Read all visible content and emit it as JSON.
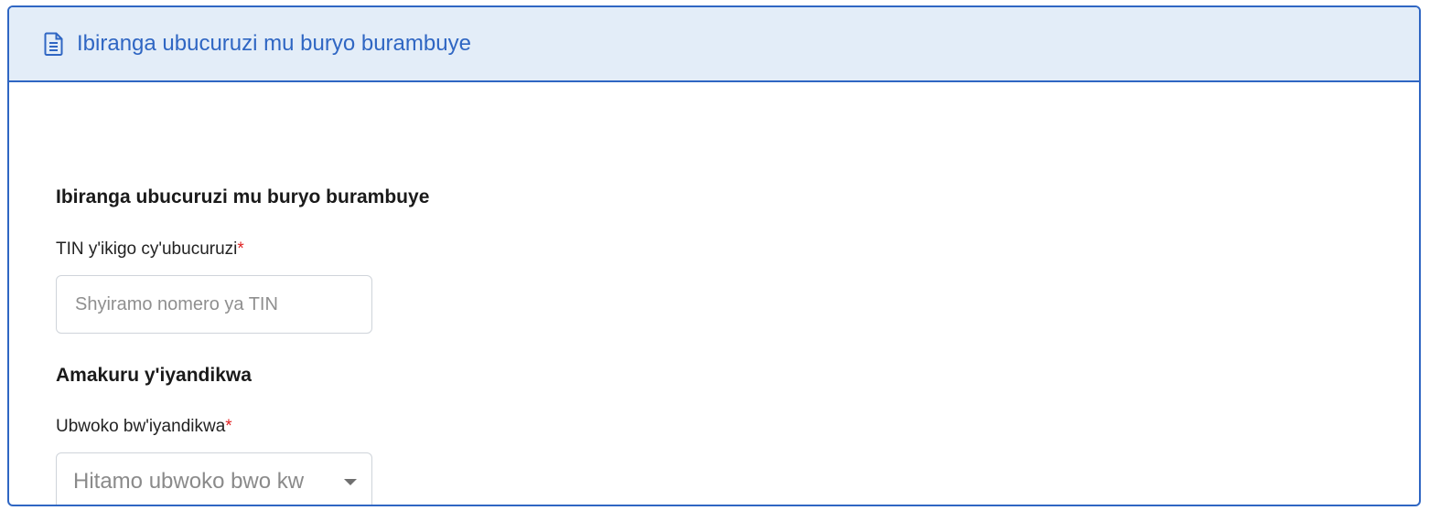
{
  "header": {
    "icon": "document-icon",
    "title": "Ibiranga ubucuruzi mu buryo burambuye"
  },
  "business_section": {
    "title": "Ibiranga ubucuruzi mu buryo burambuye",
    "tin_label": "TIN y'ikigo cy'ubucuruzi",
    "tin_required_mark": "*",
    "tin_placeholder": "Shyiramo nomero ya TIN",
    "tin_value": ""
  },
  "registration_section": {
    "title": "Amakuru y'iyandikwa",
    "type_label": "Ubwoko bw'iyandikwa",
    "type_required_mark": "*",
    "type_selected": "Hitamo ubwoko bwo kw",
    "type_caret_icon": "caret-down-icon"
  },
  "colors": {
    "accent": "#2f66c3",
    "header_bg": "#e3edf8",
    "required": "#e02424"
  }
}
